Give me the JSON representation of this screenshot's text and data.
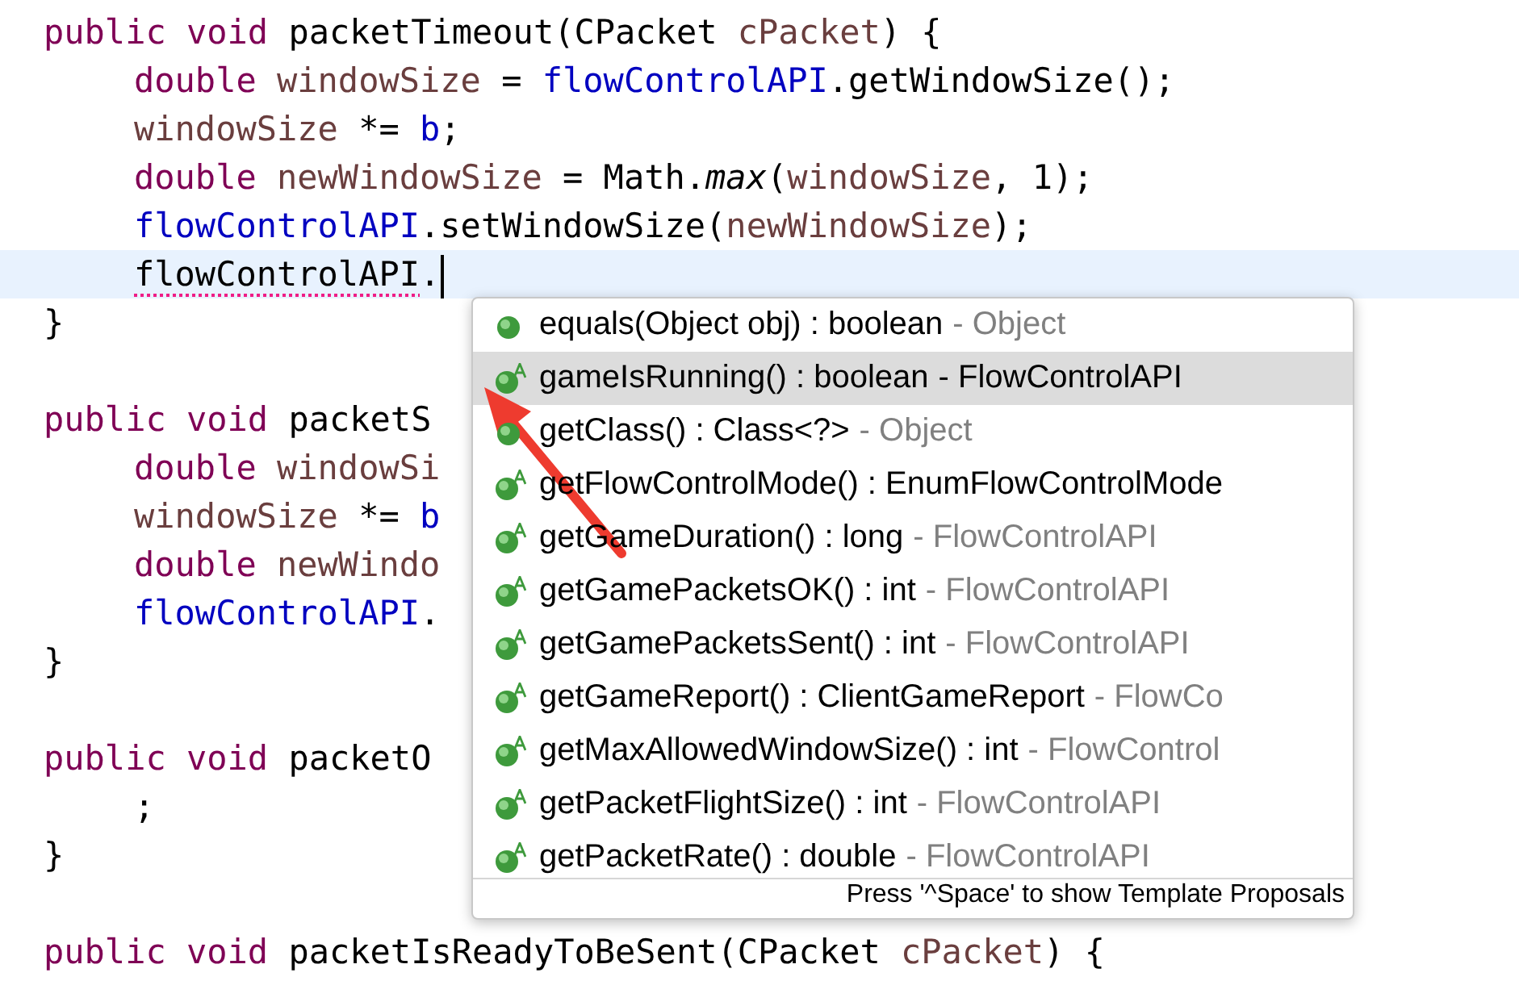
{
  "code": {
    "blocks": [
      {
        "header": {
          "current": false,
          "tokens": [
            {
              "text": "public void",
              "kind": "kw"
            },
            {
              "text": " packetTimeout(CPacket ",
              "kind": "plain"
            },
            {
              "text": "cPacket",
              "kind": "var"
            },
            {
              "text": ") {",
              "kind": "plain"
            }
          ]
        },
        "children": [
          {
            "current": false,
            "tokens": [
              {
                "text": "double",
                "kind": "kw"
              },
              {
                "text": " windowSize",
                "kind": "var"
              },
              {
                "text": " = ",
                "kind": "plain"
              },
              {
                "text": "flowControlAPI",
                "kind": "field"
              },
              {
                "text": ".getWindowSize();",
                "kind": "plain"
              }
            ]
          },
          {
            "current": false,
            "tokens": [
              {
                "text": "windowSize",
                "kind": "var"
              },
              {
                "text": " *= ",
                "kind": "plain"
              },
              {
                "text": "b",
                "kind": "field"
              },
              {
                "text": ";",
                "kind": "plain"
              }
            ]
          },
          {
            "current": false,
            "tokens": [
              {
                "text": "double",
                "kind": "kw"
              },
              {
                "text": " newWindowSize",
                "kind": "var"
              },
              {
                "text": " = Math.",
                "kind": "plain"
              },
              {
                "text": "max",
                "kind": "static"
              },
              {
                "text": "(",
                "kind": "plain"
              },
              {
                "text": "windowSize",
                "kind": "var"
              },
              {
                "text": ", 1);",
                "kind": "plain"
              }
            ]
          },
          {
            "current": false,
            "tokens": [
              {
                "text": "flowControlAPI",
                "kind": "field"
              },
              {
                "text": ".setWindowSize(",
                "kind": "plain"
              },
              {
                "text": "newWindowSize",
                "kind": "var"
              },
              {
                "text": ");",
                "kind": "plain"
              }
            ]
          },
          {
            "current": true,
            "tokens": [
              {
                "text": "flowControlAPI",
                "kind": "error"
              },
              {
                "text": ".",
                "kind": "plain"
              }
            ]
          }
        ],
        "closing": {
          "current": false,
          "tokens": [
            {
              "text": "}",
              "kind": "plain"
            }
          ]
        }
      },
      {
        "header": {
          "current": false,
          "tokens": [
            {
              "text": "public void",
              "kind": "kw"
            },
            {
              "text": " packetS",
              "kind": "plain"
            }
          ]
        },
        "children": [
          {
            "current": false,
            "tokens": [
              {
                "text": "double",
                "kind": "kw"
              },
              {
                "text": " windowSi",
                "kind": "var"
              }
            ]
          },
          {
            "current": false,
            "tokens": [
              {
                "text": "windowSize",
                "kind": "var"
              },
              {
                "text": " *= ",
                "kind": "plain"
              },
              {
                "text": "b",
                "kind": "field"
              }
            ]
          },
          {
            "current": false,
            "tokens": [
              {
                "text": "double",
                "kind": "kw"
              },
              {
                "text": " newWindo",
                "kind": "var"
              }
            ]
          },
          {
            "current": false,
            "tokens": [
              {
                "text": "flowControlAPI",
                "kind": "field"
              },
              {
                "text": ".",
                "kind": "plain"
              }
            ]
          }
        ],
        "closing": {
          "current": false,
          "tokens": [
            {
              "text": "}",
              "kind": "plain"
            }
          ]
        }
      },
      {
        "header": {
          "current": false,
          "tokens": [
            {
              "text": "public void",
              "kind": "kw"
            },
            {
              "text": " packetO",
              "kind": "plain"
            }
          ]
        },
        "children": [
          {
            "current": false,
            "tokens": [
              {
                "text": ";",
                "kind": "plain"
              }
            ]
          }
        ],
        "closing": {
          "current": false,
          "tokens": [
            {
              "text": "}",
              "kind": "plain"
            }
          ]
        }
      },
      {
        "header": {
          "current": false,
          "tokens": [
            {
              "text": "public void",
              "kind": "kw"
            },
            {
              "text": " packetIsReadyToBeSent(CPacket ",
              "kind": "plain"
            },
            {
              "text": "cPacket",
              "kind": "var"
            },
            {
              "text": ") {",
              "kind": "plain"
            }
          ]
        }
      }
    ]
  },
  "completions": {
    "items": [
      {
        "kind": "method",
        "selected": false,
        "signature": "equals(Object obj) : boolean",
        "owner": "- Object"
      },
      {
        "kind": "abstract",
        "selected": true,
        "signature": "gameIsRunning() : boolean",
        "owner": "- FlowControlAPI"
      },
      {
        "kind": "method",
        "selected": false,
        "signature": "getClass() : Class<?>",
        "owner": "- Object"
      },
      {
        "kind": "abstract",
        "selected": false,
        "signature": "getFlowControlMode() : EnumFlowControlMode"
      },
      {
        "kind": "abstract",
        "selected": false,
        "signature": "getGameDuration() : long",
        "owner": "- FlowControlAPI"
      },
      {
        "kind": "abstract",
        "selected": false,
        "signature": "getGamePacketsOK() : int",
        "owner": "- FlowControlAPI"
      },
      {
        "kind": "abstract",
        "selected": false,
        "signature": "getGamePacketsSent() : int",
        "owner": "- FlowControlAPI"
      },
      {
        "kind": "abstract",
        "selected": false,
        "signature": "getGameReport() : ClientGameReport",
        "owner": "- FlowCo"
      },
      {
        "kind": "abstract",
        "selected": false,
        "signature": "getMaxAllowedWindowSize() : int",
        "owner": "- FlowControl"
      },
      {
        "kind": "abstract",
        "selected": false,
        "signature": "getPacketFlightSize() : int",
        "owner": "- FlowControlAPI"
      },
      {
        "kind": "abstract",
        "selected": false,
        "signature": "getPacketRate() : double",
        "owner": "- FlowControlAPI"
      }
    ],
    "footer": "Press '^Space' to show Template Proposals"
  }
}
